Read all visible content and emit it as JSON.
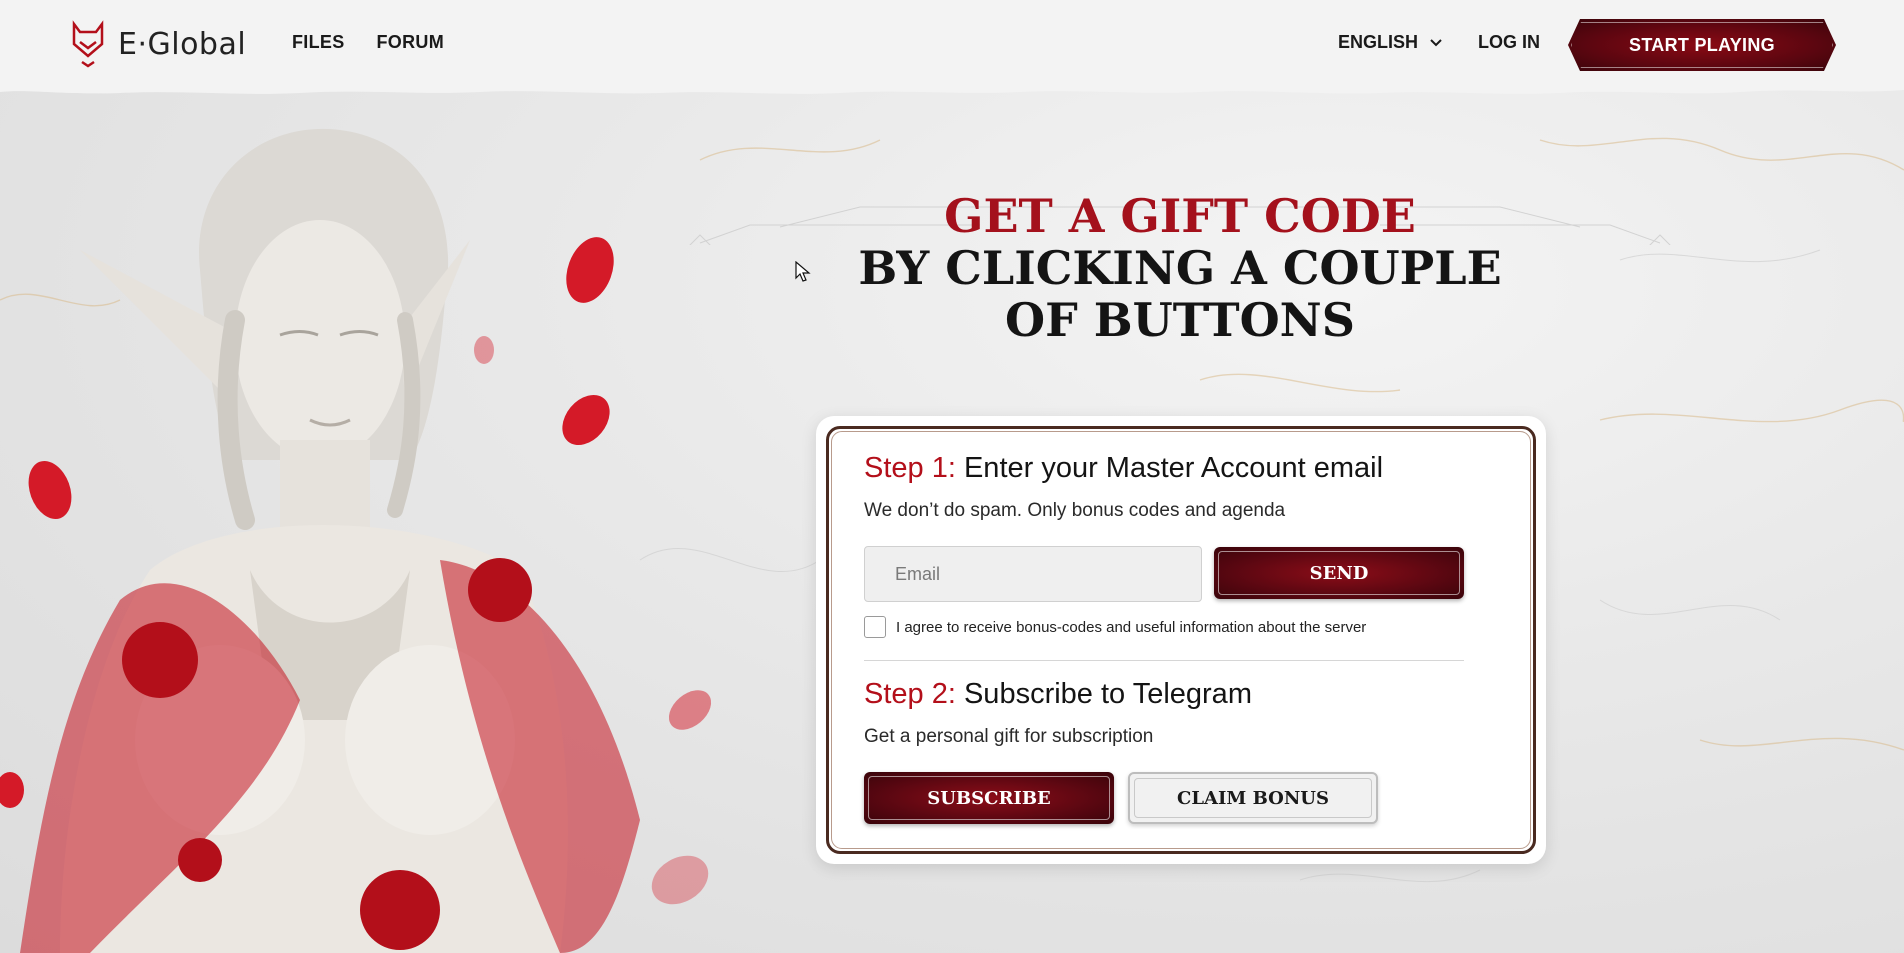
{
  "header": {
    "logo_text": "E·Global",
    "nav": [
      "FILES",
      "FORUM"
    ],
    "language": "ENGLISH",
    "login": "LOG IN",
    "start_playing": "START PLAYING"
  },
  "hero": {
    "line1": "GET A GIFT CODE",
    "line2": "BY CLICKING A COUPLE",
    "line3": "OF BUTTONS"
  },
  "step1": {
    "label": "Step 1:",
    "title": "Enter your Master Account email",
    "subtitle": "We don’t do spam. Only bonus codes and agenda",
    "email_placeholder": "Email",
    "email_value": "",
    "send": "SEND",
    "agree": "I agree to receive bonus-codes and useful information about the server"
  },
  "step2": {
    "label": "Step 2:",
    "title": "Subscribe to Telegram",
    "subtitle": "Get a personal gift for subscription",
    "subscribe": "SUBSCRIBE",
    "claim": "CLAIM BONUS"
  },
  "colors": {
    "accent": "#a4111c",
    "button_dark": "#5a0711",
    "card_border": "#4a2a20"
  }
}
